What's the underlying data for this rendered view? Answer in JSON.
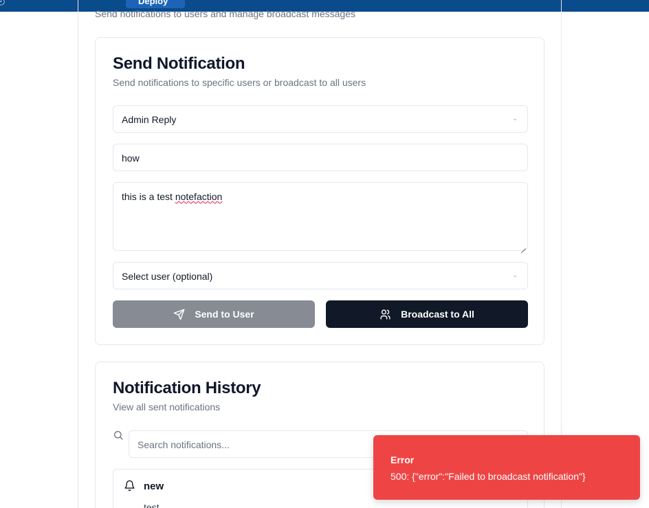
{
  "topbar": {
    "deploy_label": "Deploy"
  },
  "page": {
    "subtitle": "Send notifications to users and manage broadcast messages"
  },
  "send_card": {
    "title": "Send Notification",
    "description": "Send notifications to specific users or broadcast to all users",
    "type_select_value": "Admin Reply",
    "title_input_value": "how",
    "message_prefix": "this is a test ",
    "message_misspelled": "notefaction",
    "user_select_value": "Select user (optional)",
    "send_to_user_label": "Send to User",
    "broadcast_label": "Broadcast to All"
  },
  "history_card": {
    "title": "Notification History",
    "description": "View all sent notifications",
    "search_placeholder": "Search notifications...",
    "items": [
      {
        "title": "new",
        "body": "test"
      }
    ]
  },
  "toast": {
    "title": "Error",
    "message": "500: {\"error\":\"Failed to broadcast notification\"}",
    "color": "#ef4444"
  },
  "colors": {
    "topbar": "#0a4b8c",
    "primary_button": "#111827",
    "disabled_button": "#868b94"
  },
  "icons": [
    "send-icon",
    "users-icon",
    "search-icon",
    "bell-icon",
    "chevron-down-icon"
  ]
}
